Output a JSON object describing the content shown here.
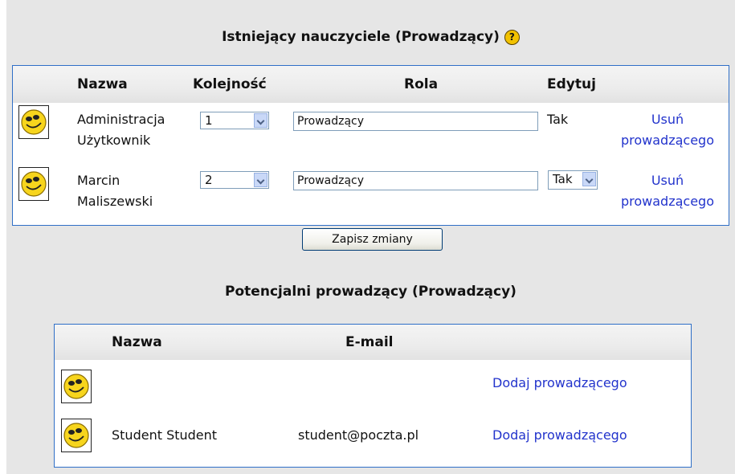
{
  "existing": {
    "title": "Istniejący nauczyciele (Prowadzący)",
    "help_icon": "?",
    "columns": {
      "name": "Nazwa",
      "order": "Kolejność",
      "role": "Rola",
      "edit": "Edytuj"
    },
    "rows": [
      {
        "name_line1": "Administracja",
        "name_line2": "Użytkownik",
        "order": "1",
        "role": "Prowadzący",
        "edit": "Tak",
        "remove_line1": "Usuń",
        "remove_line2": "prowadzącego"
      },
      {
        "name_line1": "Marcin",
        "name_line2": "Maliszewski",
        "order": "2",
        "role": "Prowadzący",
        "edit": "Tak",
        "remove_line1": "Usuń",
        "remove_line2": "prowadzącego"
      }
    ]
  },
  "save_button": "Zapisz zmiany",
  "potential": {
    "title": "Potencjalni prowadzący (Prowadzący)",
    "columns": {
      "name": "Nazwa",
      "email": "E-mail"
    },
    "rows": [
      {
        "name": "",
        "email": "",
        "add": "Dodaj prowadzącego"
      },
      {
        "name": "Student Student",
        "email": "student@poczta.pl",
        "add": "Dodaj prowadzącego"
      }
    ]
  },
  "colors": {
    "link": "#2233cc",
    "border": "#2f6fc7",
    "background": "#e6e6e6"
  }
}
